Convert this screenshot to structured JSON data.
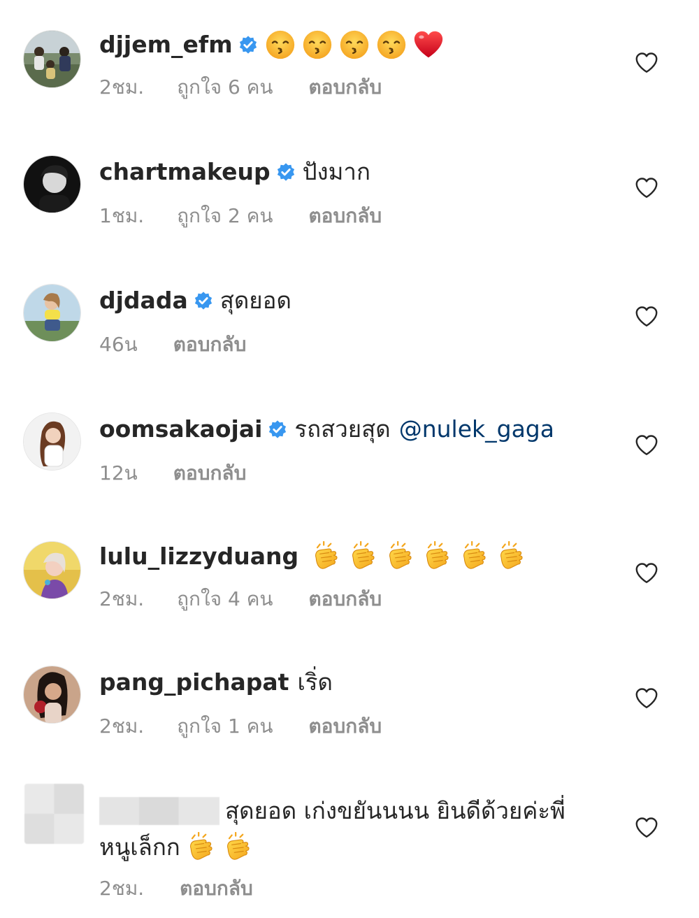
{
  "comments": [
    {
      "username": "djjem_efm",
      "verified": true,
      "text": "",
      "emoji": [
        "kissing-face",
        "kissing-face",
        "kissing-face",
        "kissing-face",
        "red-heart"
      ],
      "time": "2ชม.",
      "likes": "ถูกใจ 6 คน",
      "reply": "ตอบกลับ"
    },
    {
      "username": "chartmakeup",
      "verified": true,
      "text": "ปังมาก",
      "time": "1ชม.",
      "likes": "ถูกใจ 2 คน",
      "reply": "ตอบกลับ"
    },
    {
      "username": "djdada",
      "verified": true,
      "text": "สุดยอด",
      "time": "46น",
      "reply": "ตอบกลับ"
    },
    {
      "username": "oomsakaojai",
      "verified": true,
      "text": "รถสวยสุด",
      "mention": "@nulek_gaga",
      "time": "12น",
      "reply": "ตอบกลับ"
    },
    {
      "username": "lulu_lizzyduang",
      "verified": false,
      "text": "",
      "emoji": [
        "clapping-hands",
        "clapping-hands",
        "clapping-hands",
        "clapping-hands",
        "clapping-hands",
        "clapping-hands"
      ],
      "time": "2ชม.",
      "likes": "ถูกใจ 4 คน",
      "reply": "ตอบกลับ"
    },
    {
      "username": "pang_pichapat",
      "verified": false,
      "text": "เริ่ด",
      "time": "2ชม.",
      "likes": "ถูกใจ 1 คน",
      "reply": "ตอบกลับ"
    },
    {
      "username": "",
      "verified": false,
      "text": "สุดยอด เก่งขยันนนน ยินดีด้วยค่ะพี่",
      "text2": "หนูเล็กก",
      "emoji": [
        "clapping-hands",
        "clapping-hands"
      ],
      "time": "2ชม.",
      "reply": "ตอบกลับ"
    }
  ],
  "colors": {
    "text": "#262626",
    "meta": "#8e8e8e",
    "mention": "#00376b",
    "verified": "#3897f0"
  }
}
